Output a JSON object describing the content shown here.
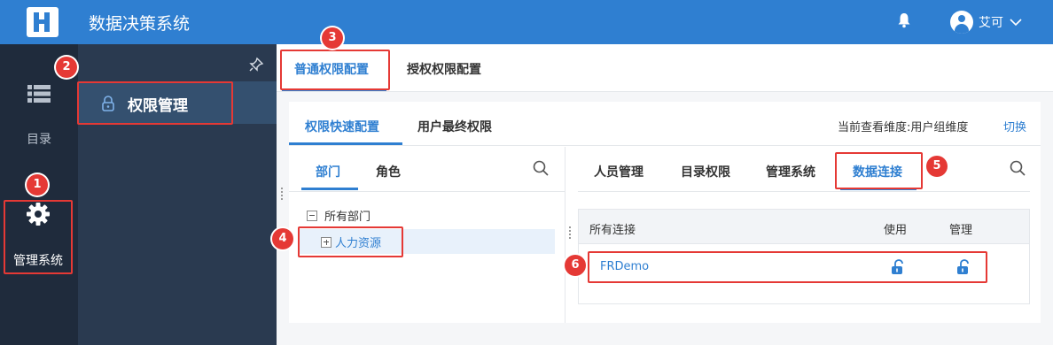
{
  "header": {
    "app_title": "数据决策系统",
    "user_name": "艾可"
  },
  "rail": {
    "directory_label": "目录",
    "management_label": "管理系统"
  },
  "sidebar": {
    "active_item_label": "权限管理"
  },
  "top_tabs": [
    {
      "label": "普通权限配置"
    },
    {
      "label": "授权权限配置"
    }
  ],
  "panel_tabs": [
    {
      "label": "权限快速配置"
    },
    {
      "label": "用户最终权限"
    }
  ],
  "dimension": {
    "label": "当前查看维度:用户组维度",
    "switch_label": "切换"
  },
  "left_tabs": [
    {
      "label": "部门"
    },
    {
      "label": "角色"
    }
  ],
  "tree": {
    "root_label": "所有部门",
    "child_label": "人力资源"
  },
  "right_tabs": [
    {
      "label": "人员管理"
    },
    {
      "label": "目录权限"
    },
    {
      "label": "管理系统"
    },
    {
      "label": "数据连接"
    }
  ],
  "table": {
    "headers": [
      "所有连接",
      "使用",
      "管理"
    ],
    "rows": [
      {
        "name": "FRDemo"
      }
    ]
  },
  "annotations": [
    "1",
    "2",
    "3",
    "4",
    "5",
    "6"
  ],
  "colors": {
    "brand": "#2f7fd1",
    "annotation": "#e53935",
    "rail": "#1f2b3c",
    "sidebar": "#2a3a50"
  }
}
